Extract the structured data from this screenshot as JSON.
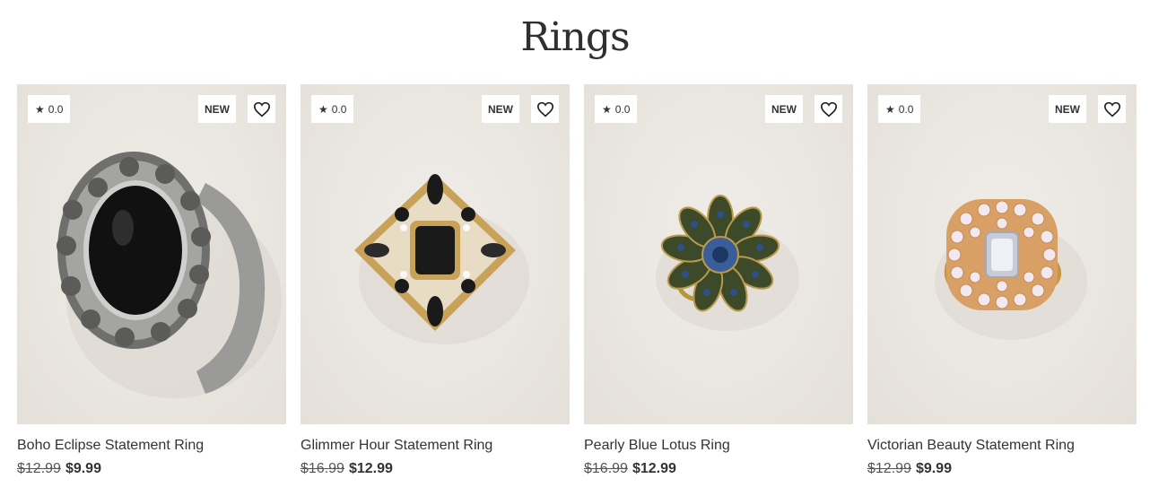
{
  "page": {
    "title": "Rings"
  },
  "colors": {
    "image_background": "#ebe7e2",
    "badge_background": "#ffffff",
    "text": "#333333"
  },
  "products": [
    {
      "rating": "0.0",
      "badge": "NEW",
      "name": "Boho Eclipse Statement Ring",
      "old_price": "$12.99",
      "price": "$9.99",
      "image_icon": "black-oval-stone-silver-ring"
    },
    {
      "rating": "0.0",
      "badge": "NEW",
      "name": "Glimmer Hour Statement Ring",
      "old_price": "$16.99",
      "price": "$12.99",
      "image_icon": "black-crystal-gold-ring"
    },
    {
      "rating": "0.0",
      "badge": "NEW",
      "name": "Pearly Blue Lotus Ring",
      "old_price": "$16.99",
      "price": "$12.99",
      "image_icon": "blue-flower-ring"
    },
    {
      "rating": "0.0",
      "badge": "NEW",
      "name": "Victorian Beauty Statement Ring",
      "old_price": "$12.99",
      "price": "$9.99",
      "image_icon": "clear-crystal-gold-ring"
    }
  ]
}
